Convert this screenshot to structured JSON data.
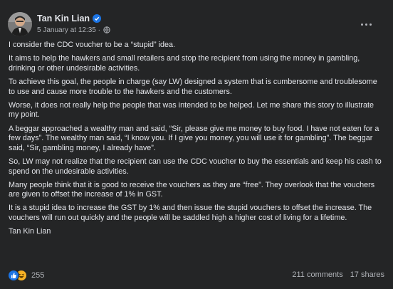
{
  "post": {
    "author": "Tan Kin Lian",
    "timestamp": "5 January at 12:35",
    "privacy_icon": "globe-icon",
    "paragraphs": [
      "I consider the CDC voucher to be a “stupid” idea.",
      "It aims to help the hawkers and small retailers and stop the recipient from using the money in gambling, drinking or other undesirable activities.",
      "To achieve this goal, the people in charge (say LW) designed a system that is cumbersome and troublesome to use and cause more trouble to the hawkers and the customers.",
      "Worse, it does not really help the people that was intended to be helped. Let me share this story to illustrate my point.",
      "A beggar approached a wealthy man and said, “Sir, please give me money to buy food. I have not eaten for a few days”. The wealthy man said, “I know you. If I give you money, you will use it for gambling”. The beggar said, “Sir, gambling money, I already have”.",
      "So, LW may not realize that the recipient can use the CDC voucher to buy the essentials and keep his cash to spend on the undesirable activities.",
      "Many people think that it is good to receive the vouchers as they are “free”. They overlook that the vouchers are given to offset the increase of 1% in GST.",
      "It is a stupid idea to increase the GST by 1% and then issue the stupid vouchers to offset the increase. The vouchers will run out quickly and the people will be saddled high a higher cost of living for a lifetime.",
      "Tan Kin Lian"
    ],
    "reaction_count": "255",
    "comments": "211 comments",
    "shares": "17 shares"
  },
  "colors": {
    "background": "#242526",
    "text_primary": "#e4e6eb",
    "text_secondary": "#b0b3b8",
    "like_blue": "#1b74e4",
    "haha_yellow": "#f7b125"
  }
}
